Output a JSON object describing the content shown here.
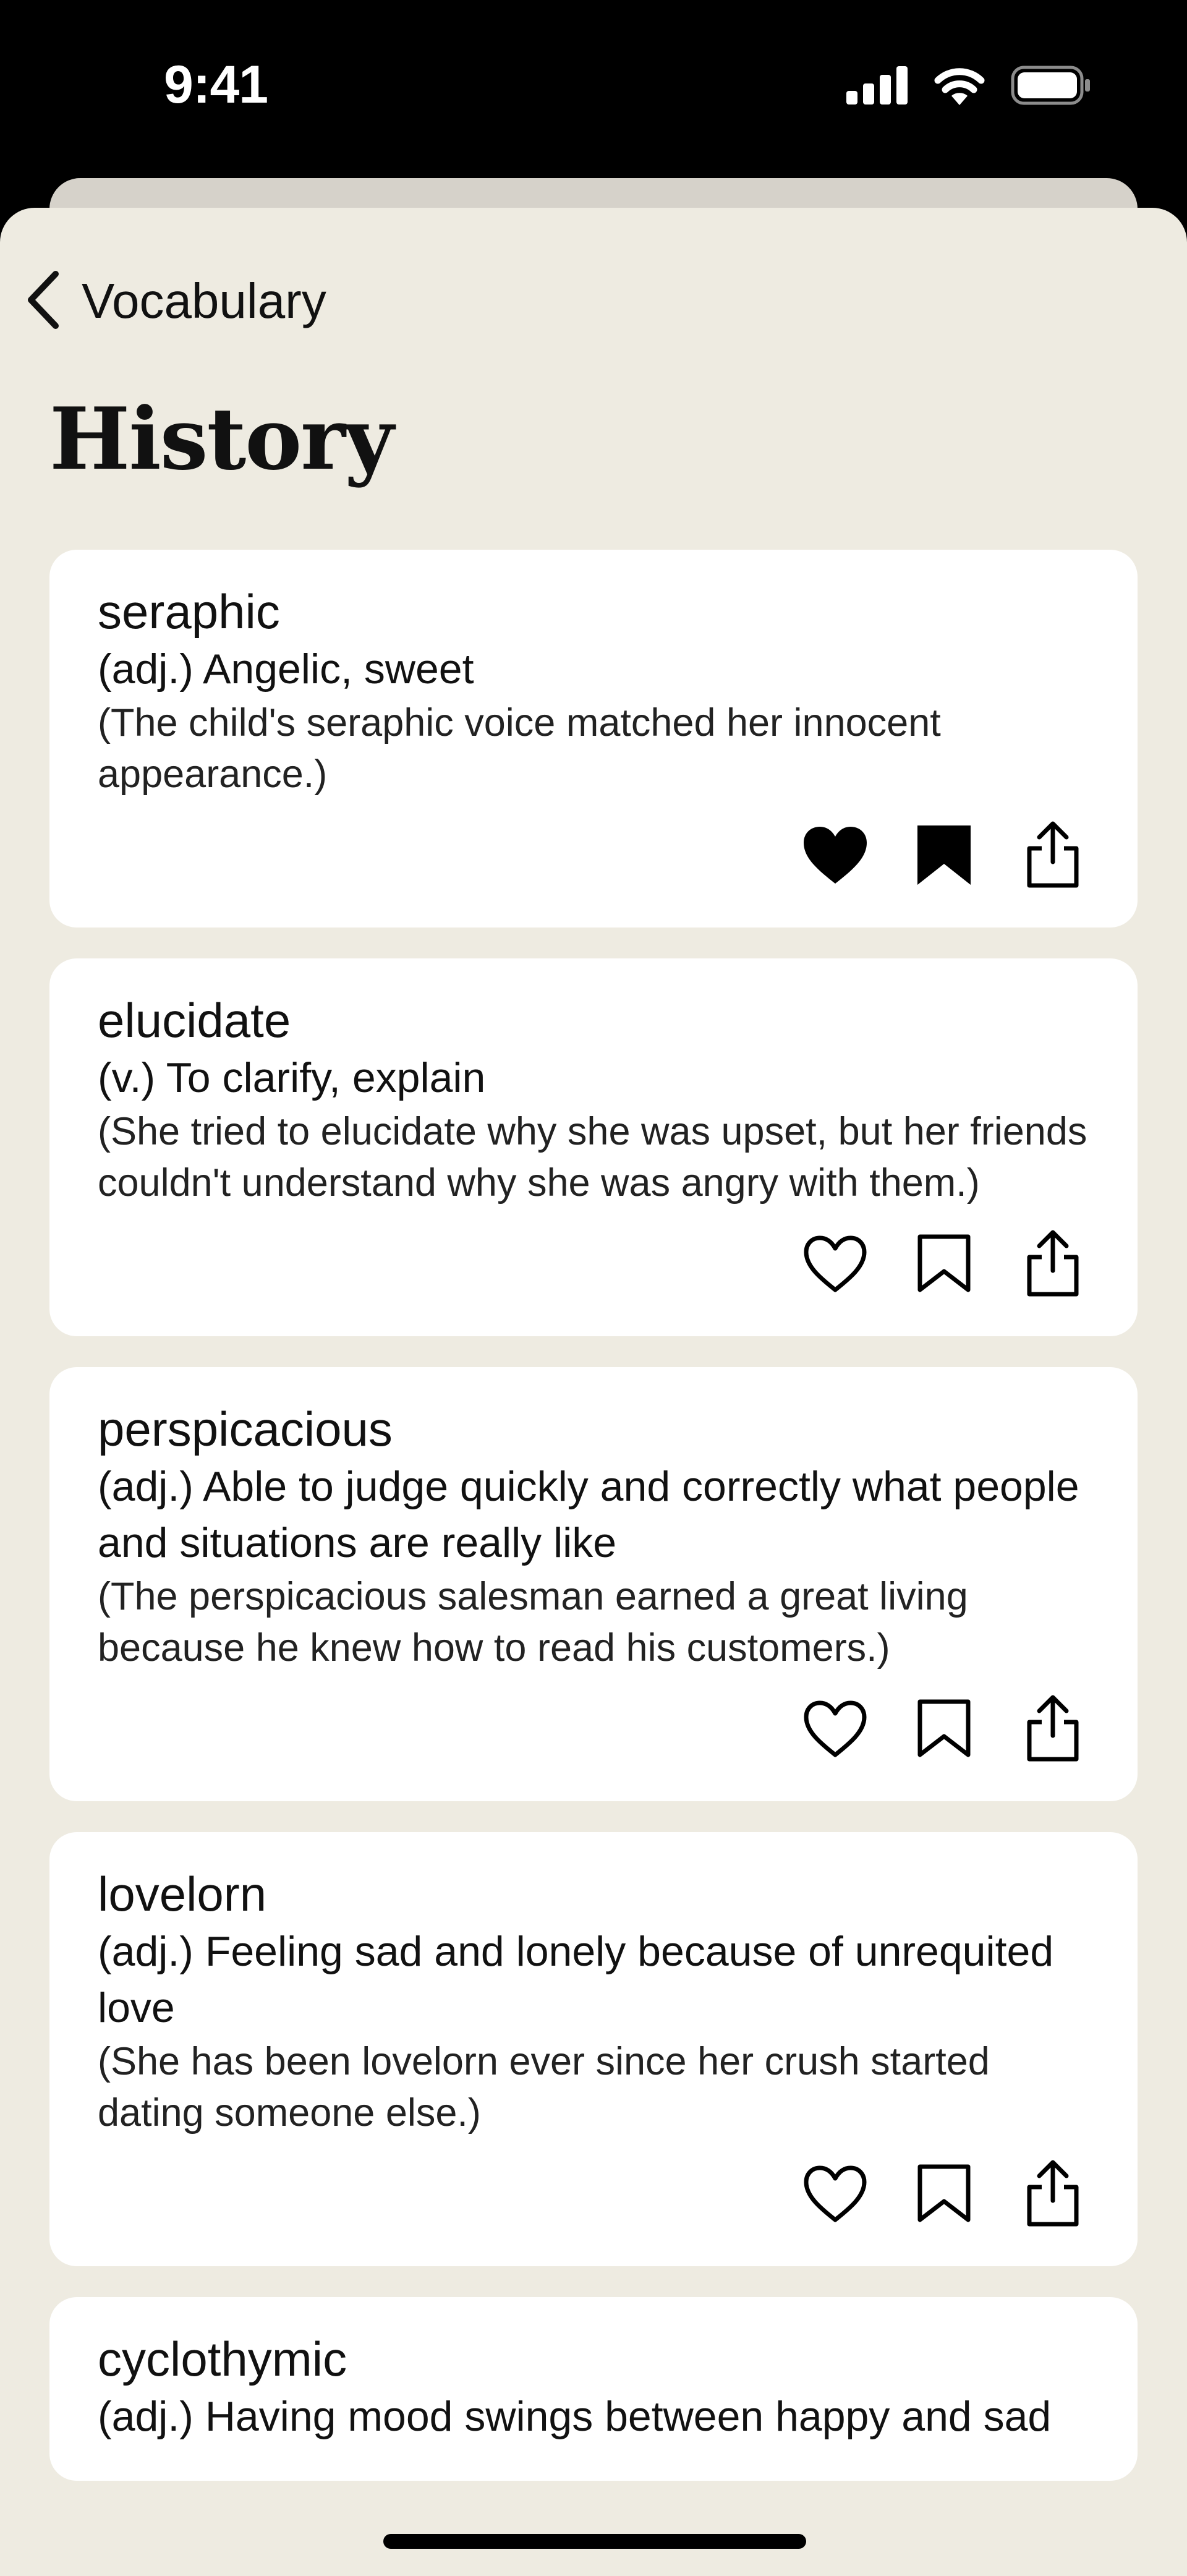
{
  "status_bar": {
    "time": "9:41"
  },
  "nav": {
    "back_label": "Vocabulary"
  },
  "page": {
    "title": "History"
  },
  "entries": [
    {
      "word": "seraphic",
      "definition": "(adj.) Angelic, sweet",
      "example": "(The child's seraphic voice matched her innocent appearance.)",
      "liked": true,
      "bookmarked": true
    },
    {
      "word": "elucidate",
      "definition": "(v.) To clarify, explain",
      "example": "(She tried to elucidate why she was upset, but her friends couldn't understand why she was angry with them.)",
      "liked": false,
      "bookmarked": false
    },
    {
      "word": "perspicacious",
      "definition": "(adj.) Able to judge quickly and correctly what people and situations are really like",
      "example": "(The perspicacious salesman earned a great living because he knew how to read his customers.)",
      "liked": false,
      "bookmarked": false
    },
    {
      "word": "lovelorn",
      "definition": "(adj.) Feeling sad and lonely because of unrequited love",
      "example": "(She has been lovelorn ever since her crush started dating someone else.)",
      "liked": false,
      "bookmarked": false
    },
    {
      "word": "cyclothymic",
      "definition": "(adj.) Having mood swings between happy and sad",
      "example": "",
      "liked": false,
      "bookmarked": false
    }
  ],
  "icons": {
    "like": "heart-icon",
    "bookmark": "bookmark-icon",
    "share": "share-icon",
    "back": "chevron-left-icon"
  },
  "colors": {
    "background": "#eeebe1",
    "card": "#ffffff",
    "text": "#111111",
    "status_bar": "#000000"
  }
}
